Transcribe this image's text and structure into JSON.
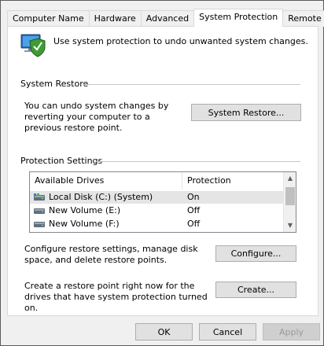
{
  "tabs": [
    "Computer Name",
    "Hardware",
    "Advanced",
    "System Protection",
    "Remote"
  ],
  "header": {
    "description": "Use system protection to undo unwanted system changes.",
    "icon": "computer-shield-icon"
  },
  "system_restore": {
    "title": "System Restore",
    "description": "You can undo system changes by reverting your computer to a previous restore point.",
    "button": "System Restore..."
  },
  "protection_settings": {
    "title": "Protection Settings",
    "columns": [
      "Available Drives",
      "Protection"
    ],
    "drives": [
      {
        "name": "Local Disk (C:) (System)",
        "protection": "On",
        "icon": "system-drive-icon"
      },
      {
        "name": "New Volume (E:)",
        "protection": "Off",
        "icon": "drive-icon"
      },
      {
        "name": "New Volume (F:)",
        "protection": "Off",
        "icon": "drive-icon"
      }
    ],
    "configure_text": "Configure restore settings, manage disk space, and delete restore points.",
    "configure_button": "Configure...",
    "create_text": "Create a restore point right now for the drives that have system protection turned on.",
    "create_button": "Create..."
  },
  "footer": {
    "ok": "OK",
    "cancel": "Cancel",
    "apply": "Apply"
  }
}
